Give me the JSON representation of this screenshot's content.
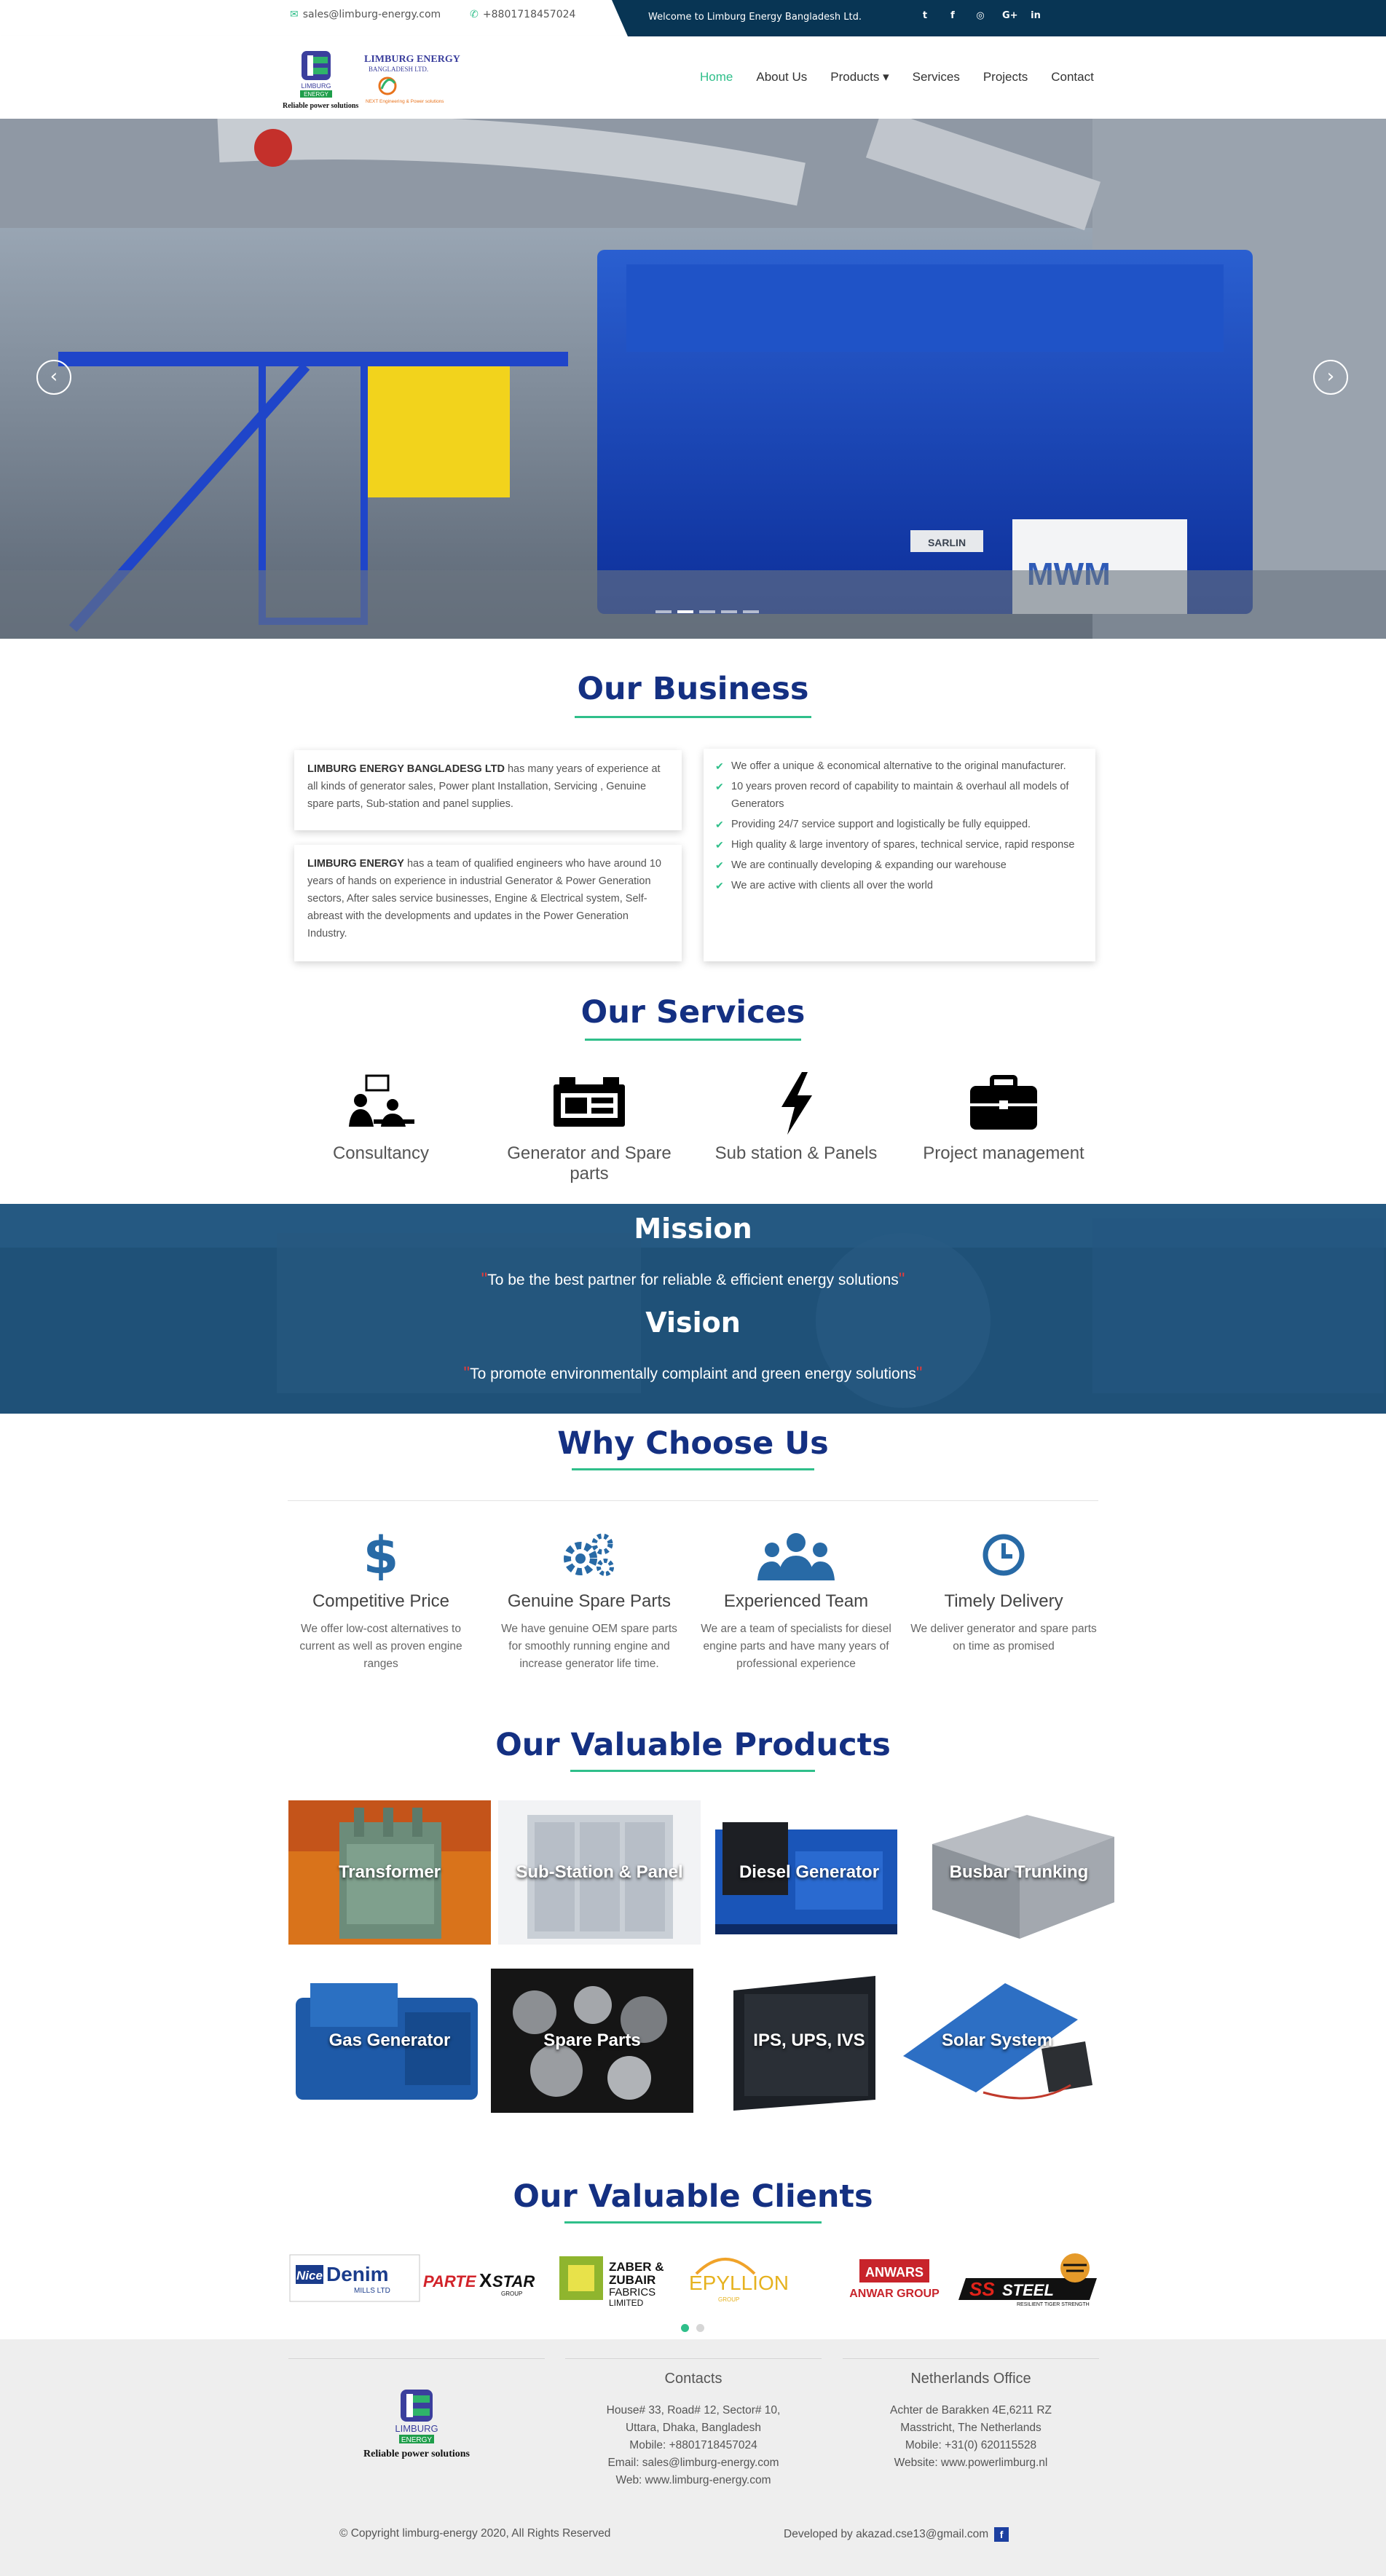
{
  "topbar": {
    "email": "sales@limburg-energy.com",
    "phone": "+8801718457024",
    "welcome": "Welcome to Limburg Energy Bangladesh Ltd.",
    "social": [
      "twitter-icon",
      "facebook-icon",
      "instagram-icon",
      "google-plus-icon",
      "linkedin-icon"
    ]
  },
  "logo": {
    "name_line1": "LIMBURG ENERGY",
    "name_line2": "BANGLADESH LTD.",
    "mark_text": "LIMBURG",
    "mark_text2": "ENERGY",
    "tagline": "Reliable power solutions",
    "partner": "NEXT Engineering & Power solutions"
  },
  "nav": {
    "items": [
      {
        "label": "Home",
        "active": true
      },
      {
        "label": "About Us"
      },
      {
        "label": "Products ▾"
      },
      {
        "label": "Services"
      },
      {
        "label": "Projects"
      },
      {
        "label": "Contact"
      }
    ]
  },
  "hero": {
    "prev": "‹",
    "next": "›",
    "slide_count": 5,
    "active_slide": 2,
    "panel_text": "MWM",
    "plate_text": "SARLIN"
  },
  "business": {
    "title": "Our Business",
    "card1_bold": "LIMBURG ENERGY BANGLADESG LTD",
    "card1_text": " has many years of experience at all kinds of generator sales, Power plant Installation, Servicing , Genuine spare parts, Sub-station and panel supplies.",
    "card2_bold": "LIMBURG ENERGY",
    "card2_text": " has a team of qualified engineers who have around 10 years of hands on experience in industrial Generator & Power Generation sectors, After sales service businesses, Engine & Electrical system, Self-abreast with the developments and updates in the Power Generation Industry.",
    "points": [
      "We offer a unique & economical alternative to the original manufacturer.",
      "10 years proven record of capability to maintain & overhaul all models of Generators",
      "Providing 24/7 service support and logistically be fully equipped.",
      "High quality & large inventory of spares, technical service, rapid response",
      "We are continually developing & expanding our warehouse",
      "We are active with clients all over the world"
    ]
  },
  "services": {
    "title": "Our Services",
    "items": [
      {
        "label": "Consultancy",
        "icon": "consultancy-icon"
      },
      {
        "label": "Generator and Spare parts",
        "icon": "generator-icon"
      },
      {
        "label": "Sub station & Panels",
        "icon": "lightning-icon"
      },
      {
        "label": "Project management",
        "icon": "briefcase-icon"
      }
    ]
  },
  "mission": {
    "mission_title": "Mission",
    "mission_text": "To be the best partner for reliable & efficient energy solutions",
    "vision_title": "Vision",
    "vision_text": "To promote environmentally complaint and green energy solutions"
  },
  "why": {
    "title": "Why Choose Us",
    "items": [
      {
        "title": "Competitive Price",
        "text": "We offer low-cost alternatives to current as well as proven engine ranges",
        "icon": "dollar-icon"
      },
      {
        "title": "Genuine Spare Parts",
        "text": "We have genuine OEM spare parts for smoothly running engine and increase generator life time.",
        "icon": "gears-icon"
      },
      {
        "title": "Experienced Team",
        "text": "We are a team of specialists for diesel engine parts and have many years of professional experience",
        "icon": "team-icon"
      },
      {
        "title": "Timely Delivery",
        "text": "We deliver generator and spare parts on time as promised",
        "icon": "clock-icon"
      }
    ]
  },
  "products": {
    "title": "Our Valuable Products",
    "items": [
      "Transformer",
      "Sub-Station & Panel",
      "Diesel Generator",
      "Busbar Trunking",
      "Gas Generator",
      "Spare Parts",
      "IPS, UPS, IVS",
      "Solar System"
    ]
  },
  "clients": {
    "title": "Our Valuable Clients",
    "logos": [
      {
        "a": "Nice",
        "b": "Denim",
        "c": "MILLS LTD"
      },
      {
        "a": "PARTE",
        "b": "X",
        "c": "STAR",
        "d": "GROUP"
      },
      {
        "a": "ZABER &",
        "b": "ZUBAIR",
        "c": "FABRICS",
        "d": "LIMITED"
      },
      {
        "a": "EPYLLION",
        "b": "GROUP"
      },
      {
        "a": "ANWARS",
        "b": "ANWAR GROUP"
      },
      {
        "a": "SS",
        "b": "STEEL",
        "c": "RESILIENT TIGER STRENGTH"
      }
    ]
  },
  "footer": {
    "logo_text": "LIMBURG",
    "logo_text2": "ENERGY",
    "tagline": "Reliable power solutions",
    "contacts_title": "Contacts",
    "contacts": [
      "House# 33, Road# 12, Sector# 10,",
      "Uttara, Dhaka, Bangladesh",
      "Mobile: +8801718457024",
      "Email: sales@limburg-energy.com",
      "Web: www.limburg-energy.com"
    ],
    "nl_title": "Netherlands Office",
    "nl": [
      "Achter de Barakken 4E,6211 RZ",
      "Masstricht, The Netherlands",
      "Mobile: +31(0) 620115528",
      "Website: www.powerlimburg.nl"
    ],
    "copyright": "© Copyright limburg-energy 2020, All Rights Reserved",
    "developer": "Developed by akazad.cse13@gmail.com",
    "developer_icon": "facebook-icon"
  },
  "colors": {
    "accent": "#2fbf8a",
    "brand": "#143082",
    "dark": "#083554"
  }
}
